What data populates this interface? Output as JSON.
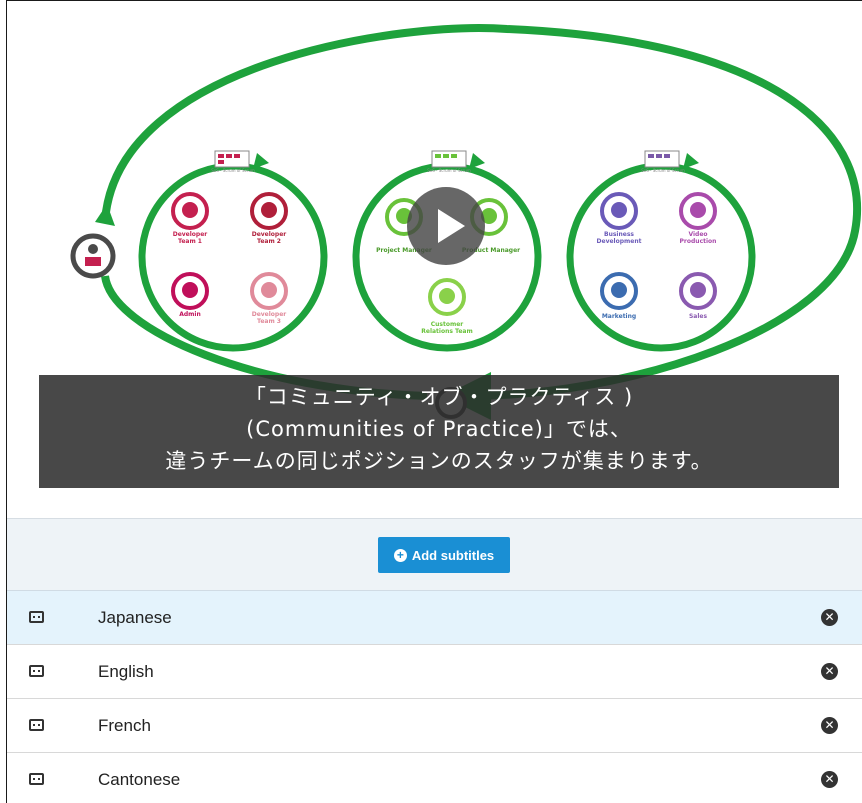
{
  "video": {
    "diagram": {
      "teams": [
        {
          "header": "SoS - Scrum of Scrum",
          "members": [
            "Developer Team 1",
            "Developer Team 2",
            "Admin",
            "Developer Team 3"
          ]
        },
        {
          "header": "SoS - Scrum of Scrum",
          "members": [
            "Project Manager",
            "Product Manager",
            "Customer Relations Team"
          ]
        },
        {
          "header": "SoS - Scrum of Scrum",
          "members": [
            "Business Development",
            "Video Production",
            "Marketing",
            "Sales"
          ]
        }
      ],
      "colors": {
        "ring": "#1ea23c",
        "team1": "#c4204f",
        "team2": "#69c23a",
        "team3": "#7a5aa8",
        "hub": "#4a4a4a"
      }
    },
    "subtitle_lines": [
      "「コミュニティ・オブ・プラクティス )",
      "(Communities of Practice)」では、",
      "違うチームの同じポジションのスタッフが集まります。"
    ],
    "play_icon": "play-icon"
  },
  "subtitles_panel": {
    "add_button_label": "Add subtitles",
    "add_icon": "plus-circle-icon"
  },
  "languages": [
    {
      "label": "Japanese",
      "selected": true
    },
    {
      "label": "English",
      "selected": false
    },
    {
      "label": "French",
      "selected": false
    },
    {
      "label": "Cantonese",
      "selected": false
    }
  ],
  "row_icons": {
    "left": "closed-caption-icon",
    "right": "remove-circle-icon"
  }
}
